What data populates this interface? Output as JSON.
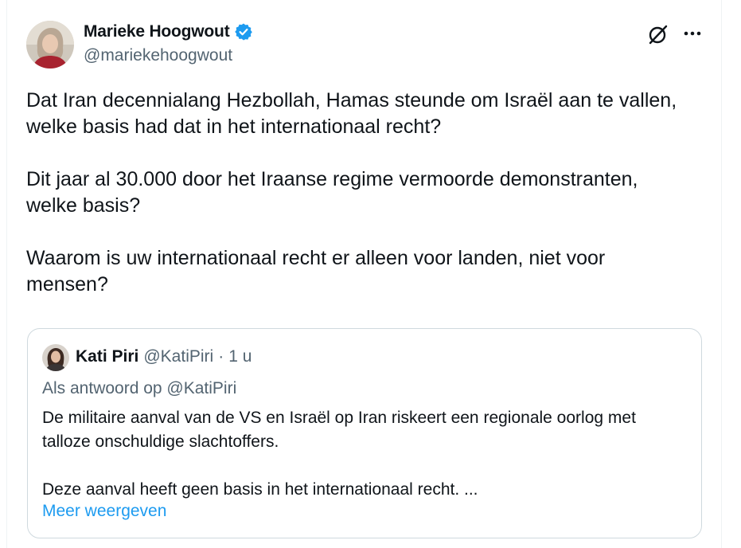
{
  "author": {
    "name": "Marieke Hoogwout",
    "handle": "@mariekehoogwout",
    "avatar_icon": "person-avatar",
    "verified_icon": "verified-badge-icon"
  },
  "actions": {
    "grok_icon": "grok-icon",
    "more_icon": "more-options-icon"
  },
  "tweet": {
    "text": "Dat Iran decennialang Hezbollah, Hamas steunde om Israël aan te vallen,\nwelke basis had dat in het internationaal recht?\n\nDit jaar al 30.000 door het Iraanse regime vermoorde demonstranten,\nwelke basis?\n\nWaarom is uw internationaal recht er alleen voor landen, niet voor\nmensen?"
  },
  "quote": {
    "name": "Kati Piri",
    "handle": "@KatiPiri",
    "separator": "·",
    "time": "1 u",
    "reply_to": "Als antwoord op @KatiPiri",
    "text": "De militaire aanval van de VS en Israël op Iran riskeert een regionale oorlog met\ntalloze onschuldige slachtoffers.\n\nDeze aanval heeft geen basis in het internationaal recht. ...",
    "show_more": "Meer weergeven"
  },
  "colors": {
    "accent": "#1d9bf0",
    "secondary_text": "#536471",
    "border": "#cfd9de"
  }
}
